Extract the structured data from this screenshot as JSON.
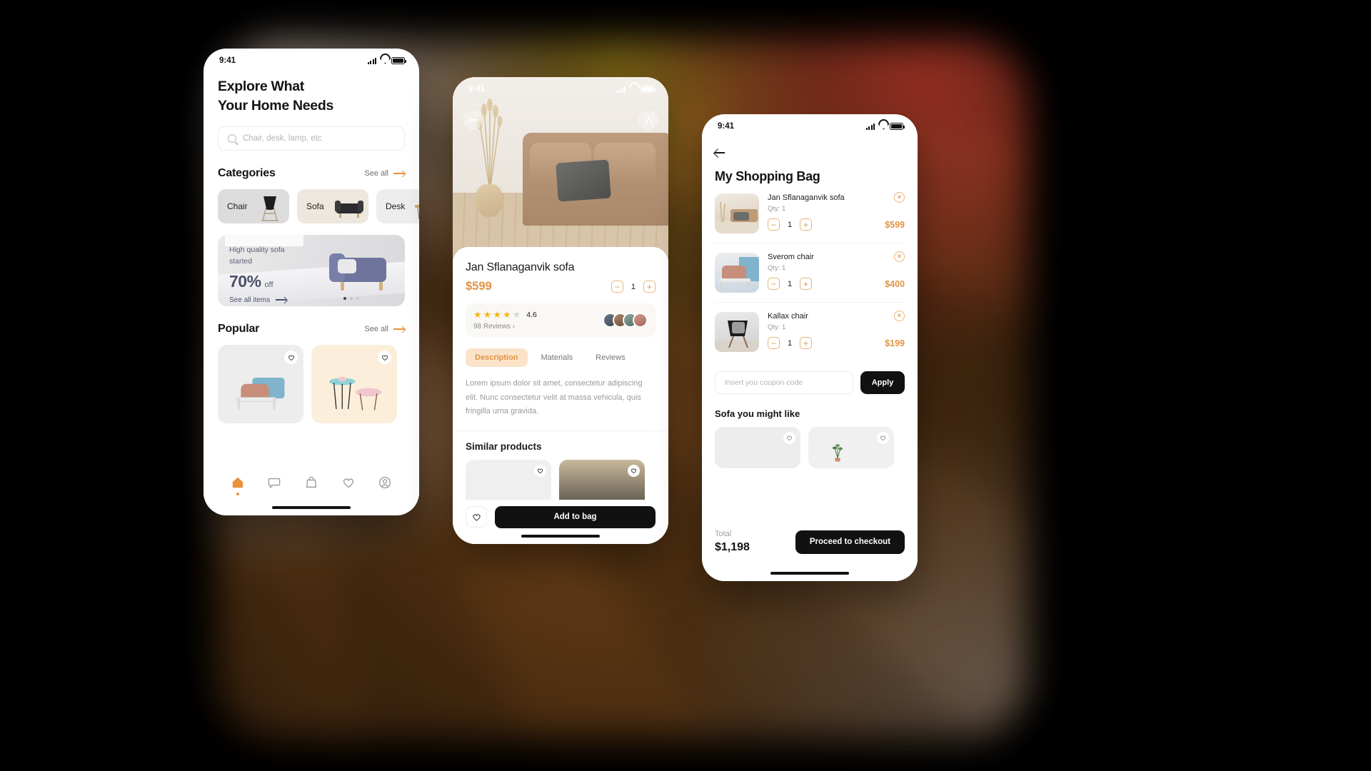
{
  "home": {
    "status_time": "9:41",
    "title_line1": "Explore What",
    "title_line2": "Your Home Needs",
    "notification_icon": "bell-icon",
    "search_placeholder": "Chair, desk, lamp, etc",
    "categories_title": "Categories",
    "see_all": "See all",
    "categories": [
      {
        "label": "Chair"
      },
      {
        "label": "Sofa"
      },
      {
        "label": "Desk"
      }
    ],
    "promo": {
      "line1": "High quality sofa",
      "line2": "started",
      "discount": "70%",
      "off": "off",
      "link": "See all items",
      "dots": 3,
      "active_dot": 0
    },
    "popular_title": "Popular",
    "popular_see_all": "See all",
    "tabbar": [
      {
        "icon": "home-icon",
        "active": true
      },
      {
        "icon": "chat-icon",
        "active": false
      },
      {
        "icon": "bag-icon",
        "active": false
      },
      {
        "icon": "heart-icon",
        "active": false
      },
      {
        "icon": "profile-icon",
        "active": false
      }
    ]
  },
  "detail": {
    "status_time": "9:41",
    "back_icon": "back-arrow-icon",
    "ar_icon": "ar-view-icon",
    "product_name": "Jan Sflanaganvik sofa",
    "price": "$599",
    "qty_minus": "−",
    "qty_value": "1",
    "qty_plus": "+",
    "rating_value": "4.6",
    "stars_filled": 4,
    "stars_total": 5,
    "reviews": "98 Reviews",
    "reviews_chevron": "›",
    "tabs": [
      {
        "label": "Description",
        "active": true
      },
      {
        "label": "Materials",
        "active": false
      },
      {
        "label": "Reviews",
        "active": false
      }
    ],
    "description": "Lorem ipsum dolor sit amet, consectetur adipiscing elit. Nunc consectetur velit at massa vehicula, quis fringilla urna gravida.",
    "similar_title": "Similar products",
    "fav_icon": "heart-icon",
    "add_to_bag": "Add to bag"
  },
  "bag": {
    "status_time": "9:41",
    "back_icon": "back-arrow-icon",
    "title": "My Shopping Bag",
    "items": [
      {
        "name": "Jan Sflanaganvik sofa",
        "qty_label": "Qty: 1",
        "qty": "1",
        "price": "$599",
        "remove_icon": "close-circle-icon"
      },
      {
        "name": "Sverom chair",
        "qty_label": "Qty: 1",
        "qty": "1",
        "price": "$400",
        "remove_icon": "close-circle-icon"
      },
      {
        "name": "Kallax chair",
        "qty_label": "Qty: 1",
        "qty": "1",
        "price": "$199",
        "remove_icon": "close-circle-icon"
      }
    ],
    "coupon_placeholder": "Insert you coupon code",
    "apply_label": "Apply",
    "suggest_title": "Sofa you might like",
    "total_label": "Total",
    "total_value": "$1,198",
    "checkout_label": "Proceed to checkout"
  },
  "colors": {
    "accent": "#E09445",
    "dark": "#111111",
    "muted": "#9A9A9A",
    "star": "#F5B417"
  }
}
